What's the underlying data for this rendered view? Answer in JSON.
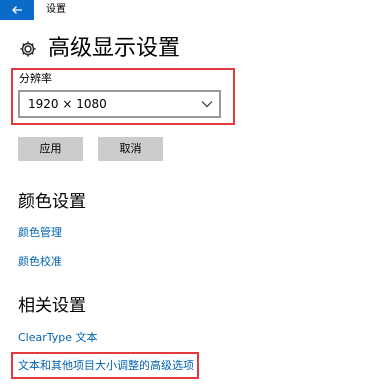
{
  "window": {
    "title": "设置",
    "back_icon": "arrow-left-icon",
    "accent_color": "#0b6bc8"
  },
  "page": {
    "title": "高级显示设置",
    "icon": "gear-icon"
  },
  "resolution": {
    "label": "分辨率",
    "value": "1920 × 1080"
  },
  "buttons": {
    "apply": "应用",
    "cancel": "取消"
  },
  "color_section": {
    "title": "颜色设置",
    "links": [
      "颜色管理",
      "颜色校准"
    ]
  },
  "related_section": {
    "title": "相关设置",
    "links": [
      "ClearType 文本",
      "文本和其他项目大小调整的高级选项"
    ]
  },
  "highlight_color": "#e03a3e"
}
